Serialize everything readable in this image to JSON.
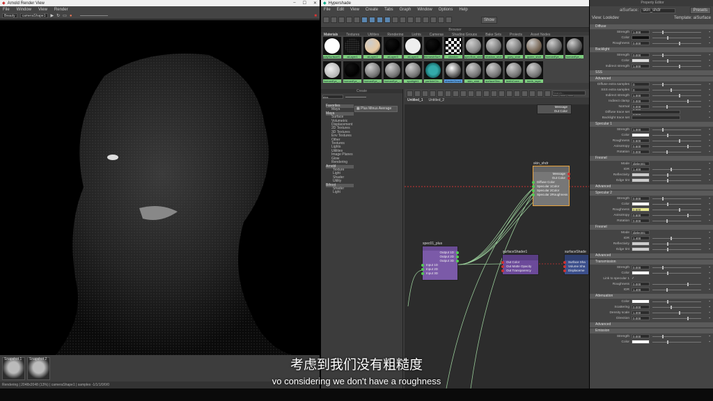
{
  "arnold_view": {
    "title": "Arnold Render View",
    "menu": [
      "File",
      "Window",
      "View",
      "Render"
    ],
    "aov": "Beauty",
    "camera": "cameraShape1",
    "snapshots": [
      "Snapshot 1",
      "Snapshot 2"
    ],
    "status": "Rendering | 2048x2048 (13%) | cameraShape1 | samples -1/1/1/0/0/0"
  },
  "hypershade": {
    "title": "Hypershade",
    "menu": [
      "File",
      "Edit",
      "View",
      "Create",
      "Tabs",
      "Graph",
      "Window",
      "Options",
      "Help"
    ],
    "show_label": "Show",
    "browser_label": "Browser",
    "browser_tabs": [
      "Materials",
      "Textures",
      "Utilities",
      "Rendering",
      "Lights",
      "Cameras",
      "Shading Groups",
      "Bake Sets",
      "Projects",
      "Asset Nodes"
    ],
    "swatches": [
      "polySurfaceS...",
      "aiLayer1",
      "aiLayer2",
      "aiLayer3",
      "aiLayer4",
      "thirmeshSurf...",
      "checker",
      "specSub_shdr",
      "shadow_shdr",
      "guey_shdr",
      "queer_shdr",
      "humanEye_...",
      "humanEye_...",
      "humanEye_...",
      "humanEye_...",
      "humanEye_...",
      "humanEye_...",
      "spotlight1",
      "particleClo...",
      "shaderGlow1",
      "skin_shdr",
      "surfaceSha...",
      "teethCorre...",
      "teeth_layer"
    ],
    "create_label": "Create",
    "search_value": "plus",
    "tree": [
      {
        "t": "Favorites",
        "c": "hd"
      },
      {
        "t": "Maya",
        "c": "sub"
      },
      {
        "t": "Maya",
        "c": "hd"
      },
      {
        "t": "Surface",
        "c": "sub"
      },
      {
        "t": "Volumetric",
        "c": "sub"
      },
      {
        "t": "Displacement",
        "c": "sub"
      },
      {
        "t": "2D Textures",
        "c": "sub"
      },
      {
        "t": "3D Textures",
        "c": "sub"
      },
      {
        "t": "Env Textures",
        "c": "sub"
      },
      {
        "t": "Other Textures",
        "c": "sub"
      },
      {
        "t": "Lights",
        "c": "sub"
      },
      {
        "t": "Utilities",
        "c": "sub"
      },
      {
        "t": "Image Planes",
        "c": "sub"
      },
      {
        "t": "Glow",
        "c": "sub"
      },
      {
        "t": "Rendering",
        "c": "sub"
      },
      {
        "t": "Arnold",
        "c": "hd"
      },
      {
        "t": "Texture",
        "c": "sub2"
      },
      {
        "t": "Light",
        "c": "sub2"
      },
      {
        "t": "Shader",
        "c": "sub2"
      },
      {
        "t": "Utility",
        "c": "sub2"
      },
      {
        "t": "Bifrost",
        "c": "hd"
      },
      {
        "t": "Shader",
        "c": "sub2"
      },
      {
        "t": "Light",
        "c": "sub2"
      }
    ],
    "plus_button": "Plus Minus Average",
    "graph_tabs": [
      "Untitled_1",
      "Untitled_2"
    ],
    "search_placeholder": "Search...",
    "nodes": {
      "skin": {
        "name": "skin_shdr",
        "rows": [
          "Message",
          "Out Color",
          "Diffuse Color",
          "Specular 1Color",
          "Specular 2Color",
          "Specular 2Roughness"
        ]
      },
      "plus": {
        "name": "spec01_plus",
        "rows": [
          "Output 1D",
          "Output 2D",
          "Output 3D",
          "Input 1D",
          "Input 2D",
          "Input 3D"
        ]
      },
      "surf": {
        "name": "surfaceShader1",
        "rows": [
          "Out Color",
          "Out Matte Opacity",
          "Out Transparency"
        ]
      },
      "surf2": {
        "name": "surfaceShade",
        "rows": [
          "Surface Sha",
          "Volume Sha",
          "Displaceme"
        ]
      },
      "top": {
        "rows": [
          "Message",
          "Out Color"
        ]
      }
    }
  },
  "attr_editor": {
    "title": "Property Editor",
    "node_label": "aiSurface:",
    "node_value": "skin_shdr",
    "presets": "Presets",
    "view": "View: Lookdev",
    "template": "Template: aiSurface",
    "sections": [
      {
        "h": "Diffuse",
        "rows": [
          [
            "Strength",
            "1.000",
            "v"
          ],
          [
            "Color",
            "",
            "c:#111"
          ],
          [
            "Roughness",
            "0.000",
            "v"
          ]
        ]
      },
      {
        "h": "Backlight",
        "rows": [
          [
            "Strength",
            "0.000",
            "v"
          ],
          [
            "Color",
            "",
            "c:#ddd"
          ],
          [
            "Indirect strength",
            "1.000",
            "v"
          ]
        ]
      },
      {
        "h": "SSS",
        "rows": []
      },
      {
        "h": "Advanced",
        "rows": [
          [
            "Diffuse extra samples",
            "0",
            "v"
          ],
          [
            "SSS extra samples",
            "0",
            "v"
          ],
          [
            "Indirect strength",
            "1.000",
            "v"
          ],
          [
            "Indirect clamp",
            "0.000",
            "v"
          ],
          [
            "Normal",
            "0.000 0.000 0.000",
            "v"
          ],
          [
            "Diffuse trace set",
            "",
            "e"
          ],
          [
            "Backlight trace set",
            "",
            "e"
          ]
        ]
      },
      {
        "h": "Specular 1",
        "rows": [
          [
            "Strength",
            "1.000",
            "v"
          ],
          [
            "Color",
            "",
            "c:#fff"
          ],
          [
            "Roughness",
            "0.500",
            "v"
          ],
          [
            "Anisotropy",
            "0.500",
            "v"
          ],
          [
            "Rotation",
            "0.000",
            "v"
          ]
        ]
      },
      {
        "h": "Fresnel",
        "rows": [
          [
            "Mode",
            "dielectric",
            "d"
          ],
          [
            "IOR",
            "1.400",
            "v"
          ],
          [
            "Reflectivity",
            "",
            "c:#ccc"
          ],
          [
            "Edge tint",
            "",
            "c:#ccc"
          ]
        ]
      },
      {
        "h": "Advanced",
        "rows": []
      },
      {
        "h": "Specular 2",
        "rows": [
          [
            "Strength",
            "0.000",
            "v"
          ],
          [
            "Color",
            "",
            "c:#fff"
          ],
          [
            "Roughness",
            "0.500",
            "y"
          ],
          [
            "Anisotropy",
            "0.500",
            "v"
          ],
          [
            "Rotation",
            "0.000",
            "v"
          ]
        ]
      },
      {
        "h": "Fresnel",
        "rows": [
          [
            "Mode",
            "dielectric",
            "d"
          ],
          [
            "IOR",
            "1.400",
            "v"
          ],
          [
            "Reflectivity",
            "",
            "c:#ccc"
          ],
          [
            "Edge tint",
            "",
            "c:#ccc"
          ]
        ]
      },
      {
        "h": "Advanced",
        "rows": []
      },
      {
        "h": "Transmission",
        "rows": [
          [
            "Strength",
            "0.000",
            "v"
          ],
          [
            "Color",
            "",
            "c:#fff"
          ],
          [
            "Link to specular 1",
            "✓",
            "k"
          ],
          [
            "Roughness",
            "0.000",
            "v"
          ],
          [
            "IOR",
            "1.400",
            "v"
          ]
        ]
      },
      {
        "h": "Attenuation",
        "rows": [
          [
            "Color",
            "",
            "c:#fff"
          ],
          [
            "Scattering",
            "0.000",
            "v"
          ],
          [
            "Density scale",
            "1.000",
            "v"
          ],
          [
            "Direction",
            "0.000",
            "v"
          ]
        ]
      },
      {
        "h": "Advanced",
        "rows": []
      },
      {
        "h": "Emission",
        "rows": [
          [
            "Strength",
            "0.000",
            "v"
          ],
          [
            "Color",
            "",
            "c:#fff"
          ]
        ]
      }
    ]
  },
  "subtitle": {
    "zh": "考虑到我们没有粗糙度",
    "en": "vo considering we don't have a roughness"
  }
}
